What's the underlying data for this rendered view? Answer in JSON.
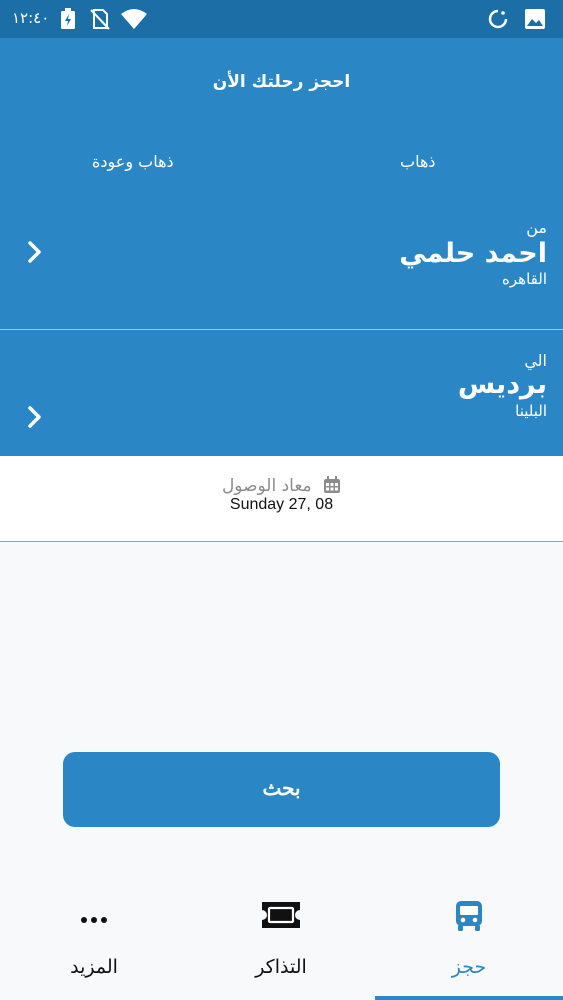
{
  "status_bar": {
    "time": "١٢:٤٠"
  },
  "header": {
    "title": "احجز رحلتك الأن",
    "trip_options": {
      "one_way": "ذهاب",
      "round_trip": "ذهاب وعودة"
    }
  },
  "from": {
    "label": "من",
    "name": "احمد حلمي",
    "city": "القاهره"
  },
  "to": {
    "label": "الي",
    "name": "برديس",
    "city": "البلينا"
  },
  "date": {
    "label": "معاد الوصول",
    "value": "Sunday 27, 08"
  },
  "search": {
    "label": "بحث"
  },
  "nav": {
    "book": "حجز",
    "tickets": "التذاكر",
    "more": "المزيد"
  },
  "colors": {
    "primary": "#2a86c5",
    "status_bar": "#1b6fa6"
  }
}
